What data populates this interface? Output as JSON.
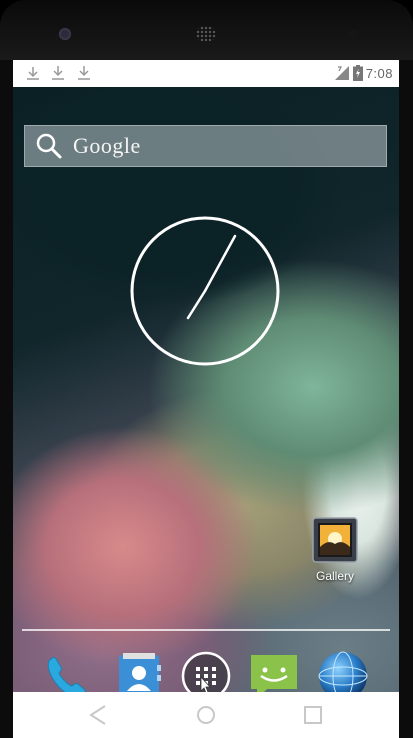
{
  "status_bar": {
    "notifications": [
      "download-done-icon",
      "download-icon",
      "download-icon"
    ],
    "time": "7:08",
    "indicators": [
      "signal-icon",
      "battery-icon"
    ]
  },
  "search": {
    "label": "Google",
    "icon": "search-icon"
  },
  "clock_widget": {
    "type": "analog-clock"
  },
  "desktop": {
    "apps": [
      {
        "label": "Gallery",
        "icon": "gallery-icon"
      }
    ]
  },
  "dock": {
    "items": [
      {
        "icon": "phone-icon"
      },
      {
        "icon": "contacts-icon"
      },
      {
        "icon": "app-drawer-icon"
      },
      {
        "icon": "messaging-icon"
      },
      {
        "icon": "browser-icon"
      }
    ]
  },
  "nav_bar": {
    "buttons": [
      "back-icon",
      "home-icon",
      "recents-icon"
    ]
  },
  "colors": {
    "status_bar_bg": "#ffffff",
    "nav_bar_bg": "#ffffff",
    "phone_blue": "#29a9e0",
    "messaging_green": "#8bc34a",
    "contacts_blue": "#3b8fd6"
  }
}
